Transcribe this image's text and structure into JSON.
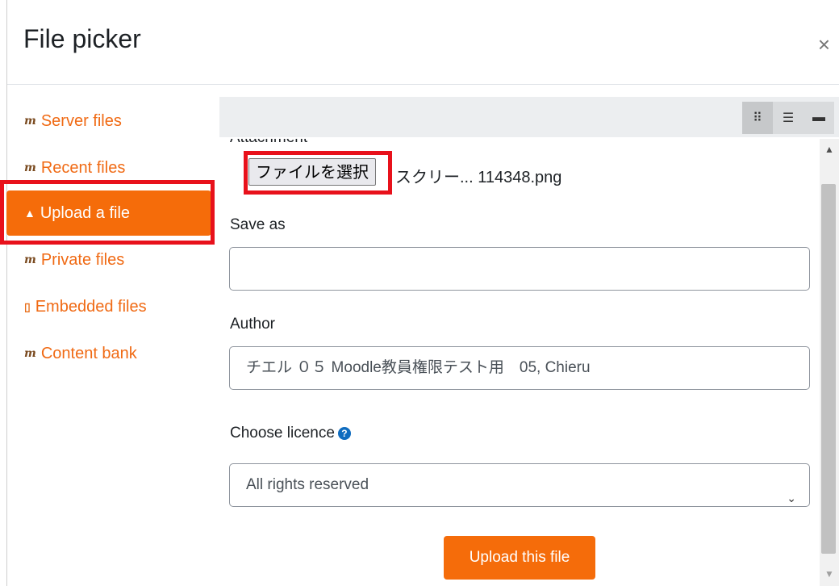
{
  "dialog": {
    "title": "File picker",
    "close_icon": "×"
  },
  "sidebar": {
    "items": [
      {
        "label": "Server files",
        "icon": "moodle-icon"
      },
      {
        "label": "Recent files",
        "icon": "moodle-icon"
      },
      {
        "label": "Upload a file",
        "icon": "upload-icon",
        "active": true
      },
      {
        "label": "Private files",
        "icon": "moodle-icon"
      },
      {
        "label": "Embedded files",
        "icon": "embedded-file-icon"
      },
      {
        "label": "Content bank",
        "icon": "moodle-icon"
      }
    ]
  },
  "toolbar": {
    "views": [
      "grid-view-icon",
      "list-view-icon",
      "folder-view-icon"
    ]
  },
  "form": {
    "attachment_label": "Attachment",
    "choose_button": "ファイルを選択",
    "file_name": "スクリー... 114348.png",
    "save_as_label": "Save as",
    "save_as_value": "",
    "author_label": "Author",
    "author_value": "チエル ０５ Moodle教員権限テスト用　05, Chieru",
    "licence_label": "Choose licence",
    "licence_value": "All rights reserved",
    "upload_button": "Upload this file"
  },
  "colors": {
    "accent": "#f56c0a",
    "highlight": "#e8111b",
    "link": "#f06a14"
  }
}
